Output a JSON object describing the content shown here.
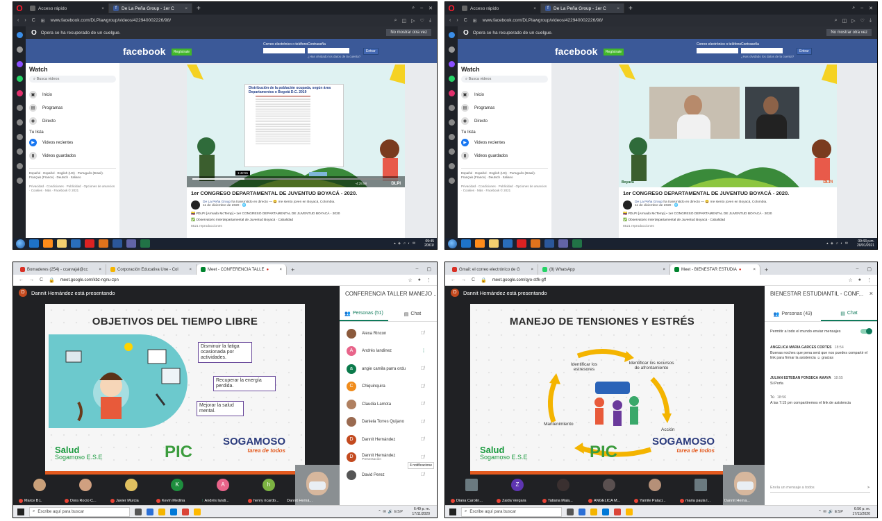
{
  "q1": {
    "tabs": [
      "Acceso rápido",
      "De La Peña Group - 1er C"
    ],
    "url": "www.facebook.com/DLPlawgroup/videos/422940002226/98/",
    "notice": "Opera se ha recuperado de un cuelgue.",
    "notice_btn": "No mostrar otra vez",
    "fb": {
      "logo": "facebook",
      "register": "Regístrate",
      "email_label": "Correo electrónico o teléfono",
      "pass_label": "Contraseña",
      "enter": "Entrar",
      "forgot": "¿Has olvidado los datos de la cuenta?",
      "watch": "Watch",
      "search": "Busca videos",
      "nav": [
        "Inicio",
        "Programas",
        "Directo"
      ],
      "list_title": "Tu lista",
      "list": [
        "Videos recientes",
        "Videos guardados"
      ],
      "langs": "Español · Español · English (US) · Português (Brasil) · Français (France) · Deutsch · Italiano",
      "footer": "Privacidad · Condiciones · Publicidad · Opciones de anuncios · Cookies · Más · Facebook © 2021",
      "title": "1er CONGRESO DEPARTAMENTAL DE JUVENTUD BOYACÁ - 2020.",
      "post_author": "De La Peña Group",
      "post_text": "ha transmitido en directo — 😀 me siento joven en Boyacá, Colombia.",
      "post_date": "11 de diciembre de 2020 · 🌐",
      "line1": "🇨🇴 #DLPI [Armado McTemp] • 1er CONGRESO DEPARTAMENTAL DE JUVENTUD BOYACÁ - 2020",
      "line2": "✅ Observatorio Interdepartamental de Juventud Boyacá · Cabalidad",
      "views": "8521 reproducciones"
    },
    "slide_doc_title": "Distribución de la población ocupada, según área Departamentos o Bogotá D.C. 2019",
    "video_tip": "1:42:55",
    "video_time": "-4:25:58",
    "brand": "DLPI",
    "clock_time": "09:45",
    "clock_date": "20/01/"
  },
  "q2": {
    "tabs": [
      "Acceso rápido",
      "De La Peña Group - 1er C"
    ],
    "url": "www.facebook.com/DLPlawgroup/videos/422940002226/98/",
    "notice": "Opera se ha recuperado de un cuelgue.",
    "notice_btn": "No mostrar otra vez",
    "boyaca": "Boyacá",
    "brand": "DLPI",
    "clock_time": "09:43 p.m.",
    "clock_date": "20/01/2021"
  },
  "q3": {
    "tabs": [
      "Bomaderes (254) - ccarvajal@cc",
      "Corporación Educativa Une - Col",
      "Meet - CONFERENCIA TALLE"
    ],
    "url": "meet.google.com/kbz-ngnu-zpn",
    "presenting": "Dannit Hernández está presentando",
    "slide_title": "OBJETIVOS DEL TIEMPO LIBRE",
    "boxes": [
      "Disminuir la fatiga ocasionada por actividades.",
      "Recuperar la energía perdida.",
      "Mejorar la salud mental."
    ],
    "salud": "Salud",
    "salud_sub": "Sogamoso E.S.E",
    "pic": "PIC",
    "soga": "SOGAMOSO",
    "soga_tag": "tarea de todos",
    "panel_title": "CONFERENCIA TALLER MANEJO ...",
    "tab_people": "Personas (51)",
    "tab_chat": "Chat",
    "people": [
      {
        "name": "Alexa Rincon",
        "initial": "",
        "color": "#8b5a3c"
      },
      {
        "name": "Andrés landinez",
        "initial": "A",
        "color": "#e8648a"
      },
      {
        "name": "angie camila parra ordu",
        "initial": "a",
        "color": "#0b7a4b"
      },
      {
        "name": "Chiquinquira",
        "initial": "C",
        "color": "#f08c1c"
      },
      {
        "name": "Claudia Lamota",
        "initial": "",
        "color": "#b08060"
      },
      {
        "name": "Daniela Torres Quijano",
        "initial": "",
        "color": "#9a6a50"
      },
      {
        "name": "Dannit Hernández",
        "initial": "D",
        "color": "#c34a1f"
      },
      {
        "name": "Dannit Hernández",
        "sub": "Presentación",
        "initial": "D",
        "color": "#c34a1f"
      },
      {
        "name": "David Perez",
        "initial": "",
        "color": "#555"
      }
    ],
    "notif": "4 notificacione",
    "thumbs": [
      {
        "name": "Marce B.L",
        "initial": "",
        "color": "#c9a07a"
      },
      {
        "name": "Dora Rocio C...",
        "initial": "",
        "color": "#d0a080"
      },
      {
        "name": "Javier Murcia",
        "initial": "",
        "color": "#e0c060"
      },
      {
        "name": "Kevin Medina",
        "initial": "K",
        "color": "#1e8e3e"
      },
      {
        "name": "Andrés landi...",
        "initial": "A",
        "color": "#e8648a"
      },
      {
        "name": "henry ricardo...",
        "initial": "h",
        "color": "#7cb342"
      }
    ],
    "self_name": "Dannit Herná...",
    "search": "Escribe aquí para buscar",
    "clock_time": "6:49 p. m.",
    "clock_date": "17/11/2020"
  },
  "q4": {
    "tabs": [
      "Gmail: el correo electrónico de G",
      "(8) WhatsApp",
      "Meet - BIENESTAR ESTUDIA"
    ],
    "url": "meet.google.com/qyo-stfk-gff",
    "presenting": "Dannit Hernández está presentando",
    "slide_title": "MANEJO DE TENSIONES Y ESTRÉS",
    "cycle": [
      "Identificar los estresores",
      "Identificar los recursos de afrontamiento",
      "Acción",
      "Mantenimiento"
    ],
    "salud": "Salud",
    "salud_sub": "Sogamoso E.S.E",
    "pic": "PIC",
    "soga": "SOGAMOSO",
    "soga_tag": "tarea de todos",
    "panel_title": "BIENESTAR ESTUDIANTIL - CONF...",
    "tab_people": "Personas (43)",
    "tab_chat": "Chat",
    "toggle": "Permitir a todo el mundo enviar mensajes",
    "messages": [
      {
        "who": "ANGELICA MARIA GARCES CORTES",
        "time": "18:54",
        "text": "Buenas noches que pena será que nos puedes compartir el link para firmar la asistencia ☺ gracias"
      },
      {
        "who": "JULIAN ESTEBAN FONSECA AMAYA",
        "time": "18:55",
        "text": "Si Porfa"
      },
      {
        "who": "Tú",
        "time": "18:56",
        "text": "A las 7:15 pm compartiremos el link de asistencia"
      }
    ],
    "chat_placeholder": "Envía un mensaje a todos",
    "thumbs": [
      {
        "name": "Diana Carolin...",
        "initial": "",
        "color": "#6b7a80"
      },
      {
        "name": "Zaida Vergara",
        "initial": "Z",
        "color": "#5e35b1"
      },
      {
        "name": "Tatiana Mala...",
        "initial": "",
        "color": "#3a3030"
      },
      {
        "name": "ANGELICA M...",
        "initial": "",
        "color": "#5a5050"
      },
      {
        "name": "Yamile Palaci...",
        "initial": "",
        "color": "#b59078"
      },
      {
        "name": "maria paula l...",
        "initial": "",
        "color": "#6b7a80"
      }
    ],
    "self_name": "Dannit Herna...",
    "search": "Escribe aquí para buscar",
    "clock_time": "6:56 p. m.",
    "clock_date": "17/11/2020"
  },
  "colors": {
    "fb_blue": "#3b5998",
    "meet_green": "#0f7a5b",
    "meet_dark": "#202124",
    "orange": "#e35a1f"
  }
}
